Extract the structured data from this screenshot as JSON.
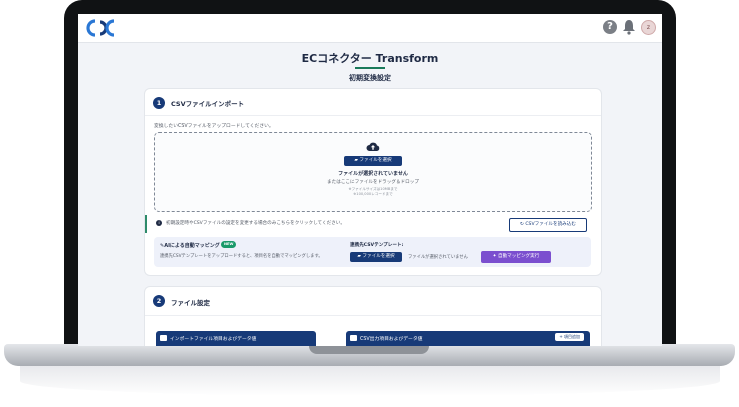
{
  "app": {
    "title": "ECコネクター Transform",
    "subtitle": "初期変換設定",
    "help_glyph": "?",
    "avatar_initial": "z"
  },
  "step1": {
    "number": "1",
    "title": "CSVファイルインポート",
    "instruction": "変換したいCSVファイルをアップロードしてください。",
    "select_button": "ファイルを選択",
    "no_file": "ファイルが選択されていません",
    "drag_text": "またはここにファイルをドラッグ＆ドロップ",
    "size_note": "※ファイルサイズは10MBまで",
    "record_note": "※100,000レコードまで",
    "info_text": "初期設定時やCSVファイルの設定を変更する場合のみこちらをクリックしてください。",
    "load_button": "CSVファイルを読み込む",
    "ai_title": "AIによる自動マッピング",
    "new_badge": "NEW",
    "ai_desc": "連携先CSVテンプレートをアップロードすると、項目名を自動でマッピングします。",
    "template_label": "連携先CSVテンプレート:",
    "template_button": "ファイルを選択",
    "template_no_file": "ファイルが選択されていません",
    "auto_button": "自動マッピング実行"
  },
  "step2": {
    "number": "2",
    "title": "ファイル設定",
    "left_panel": "インポートファイル項目およびデータ値",
    "right_panel": "CSV出力項目およびデータ値",
    "add_button": "+ 項目追加"
  },
  "colors": {
    "primary": "#173a78",
    "accent": "#1a7a5a",
    "purple": "#7b4fcf"
  }
}
